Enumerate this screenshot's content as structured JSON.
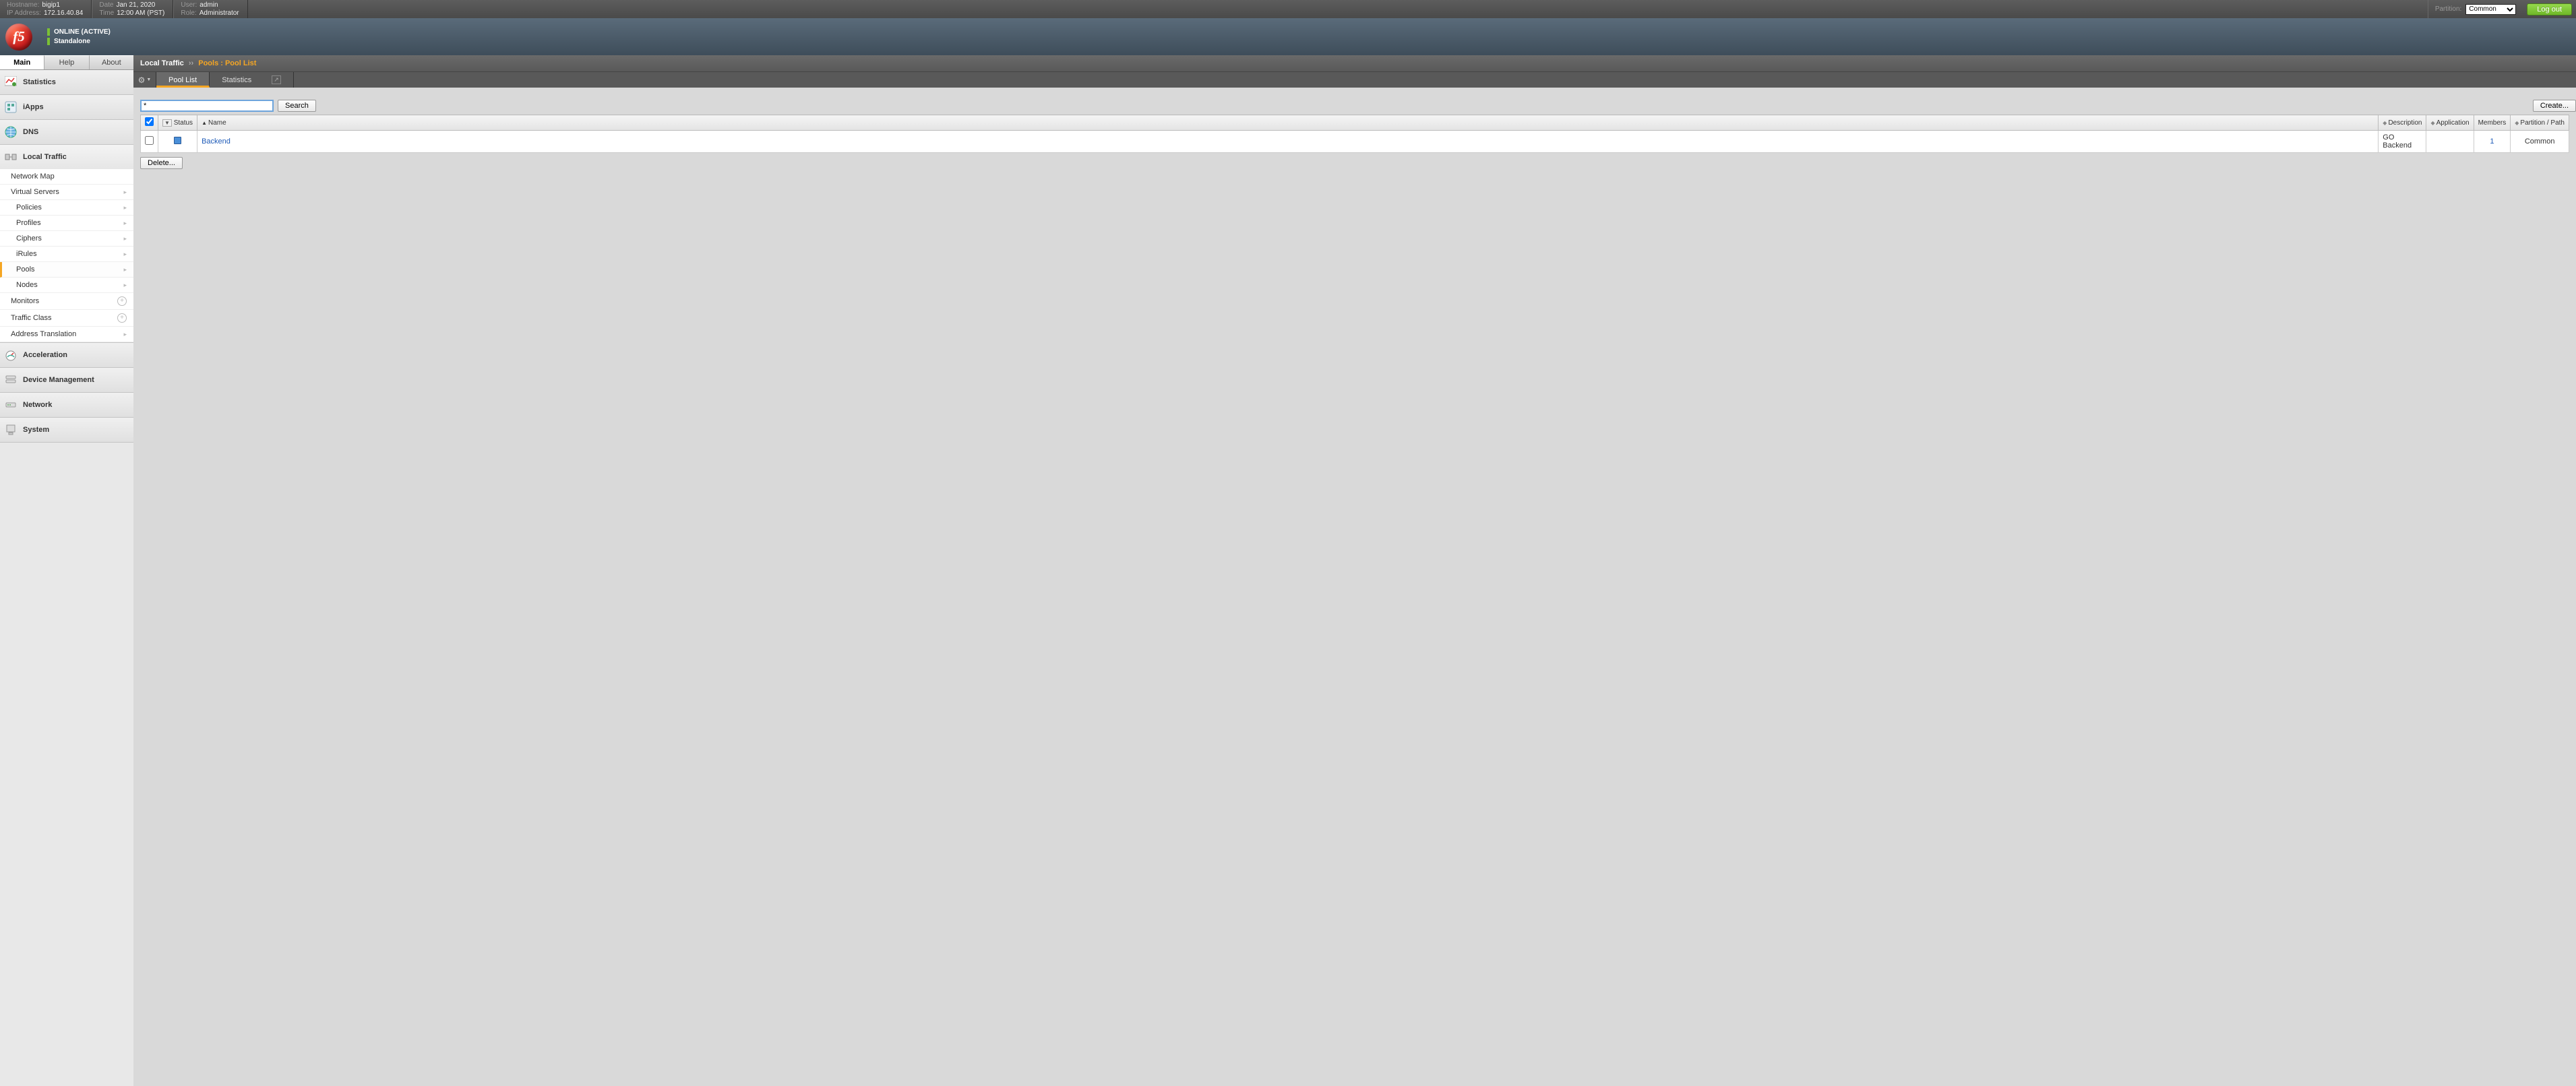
{
  "topbar": {
    "hostname_label": "Hostname:",
    "hostname": "bigip1",
    "ip_label": "IP Address:",
    "ip": "172.16.40.84",
    "date_label": "Date",
    "date": "Jan 21, 2020",
    "time_label": "Time",
    "time": "12:00 AM (PST)",
    "user_label": "User:",
    "user": "admin",
    "role_label": "Role:",
    "role": "Administrator",
    "partition_label": "Partition:",
    "partition_selected": "Common",
    "logout": "Log out"
  },
  "banner": {
    "status1": "ONLINE (ACTIVE)",
    "status2": "Standalone",
    "logo_text": "f5"
  },
  "nav_tabs": {
    "main": "Main",
    "help": "Help",
    "about": "About"
  },
  "sidebar": {
    "statistics": "Statistics",
    "iapps": "iApps",
    "dns": "DNS",
    "local_traffic": "Local Traffic",
    "lt": {
      "network_map": "Network Map",
      "virtual_servers": "Virtual Servers",
      "policies": "Policies",
      "profiles": "Profiles",
      "ciphers": "Ciphers",
      "irules": "iRules",
      "pools": "Pools",
      "nodes": "Nodes",
      "monitors": "Monitors",
      "traffic_class": "Traffic Class",
      "address_translation": "Address Translation"
    },
    "acceleration": "Acceleration",
    "device_management": "Device Management",
    "network": "Network",
    "system": "System"
  },
  "breadcrumb": {
    "section": "Local Traffic",
    "current": "Pools : Pool List"
  },
  "content_tabs": {
    "pool_list": "Pool List",
    "statistics": "Statistics"
  },
  "search": {
    "value": "*",
    "button": "Search"
  },
  "create_button": "Create...",
  "columns": {
    "status": "Status",
    "name": "Name",
    "description": "Description",
    "application": "Application",
    "members": "Members",
    "partition": "Partition / Path"
  },
  "rows": [
    {
      "name": "Backend",
      "description": "GO Backend",
      "application": "",
      "members": "1",
      "partition": "Common"
    }
  ],
  "actions": {
    "delete": "Delete..."
  }
}
